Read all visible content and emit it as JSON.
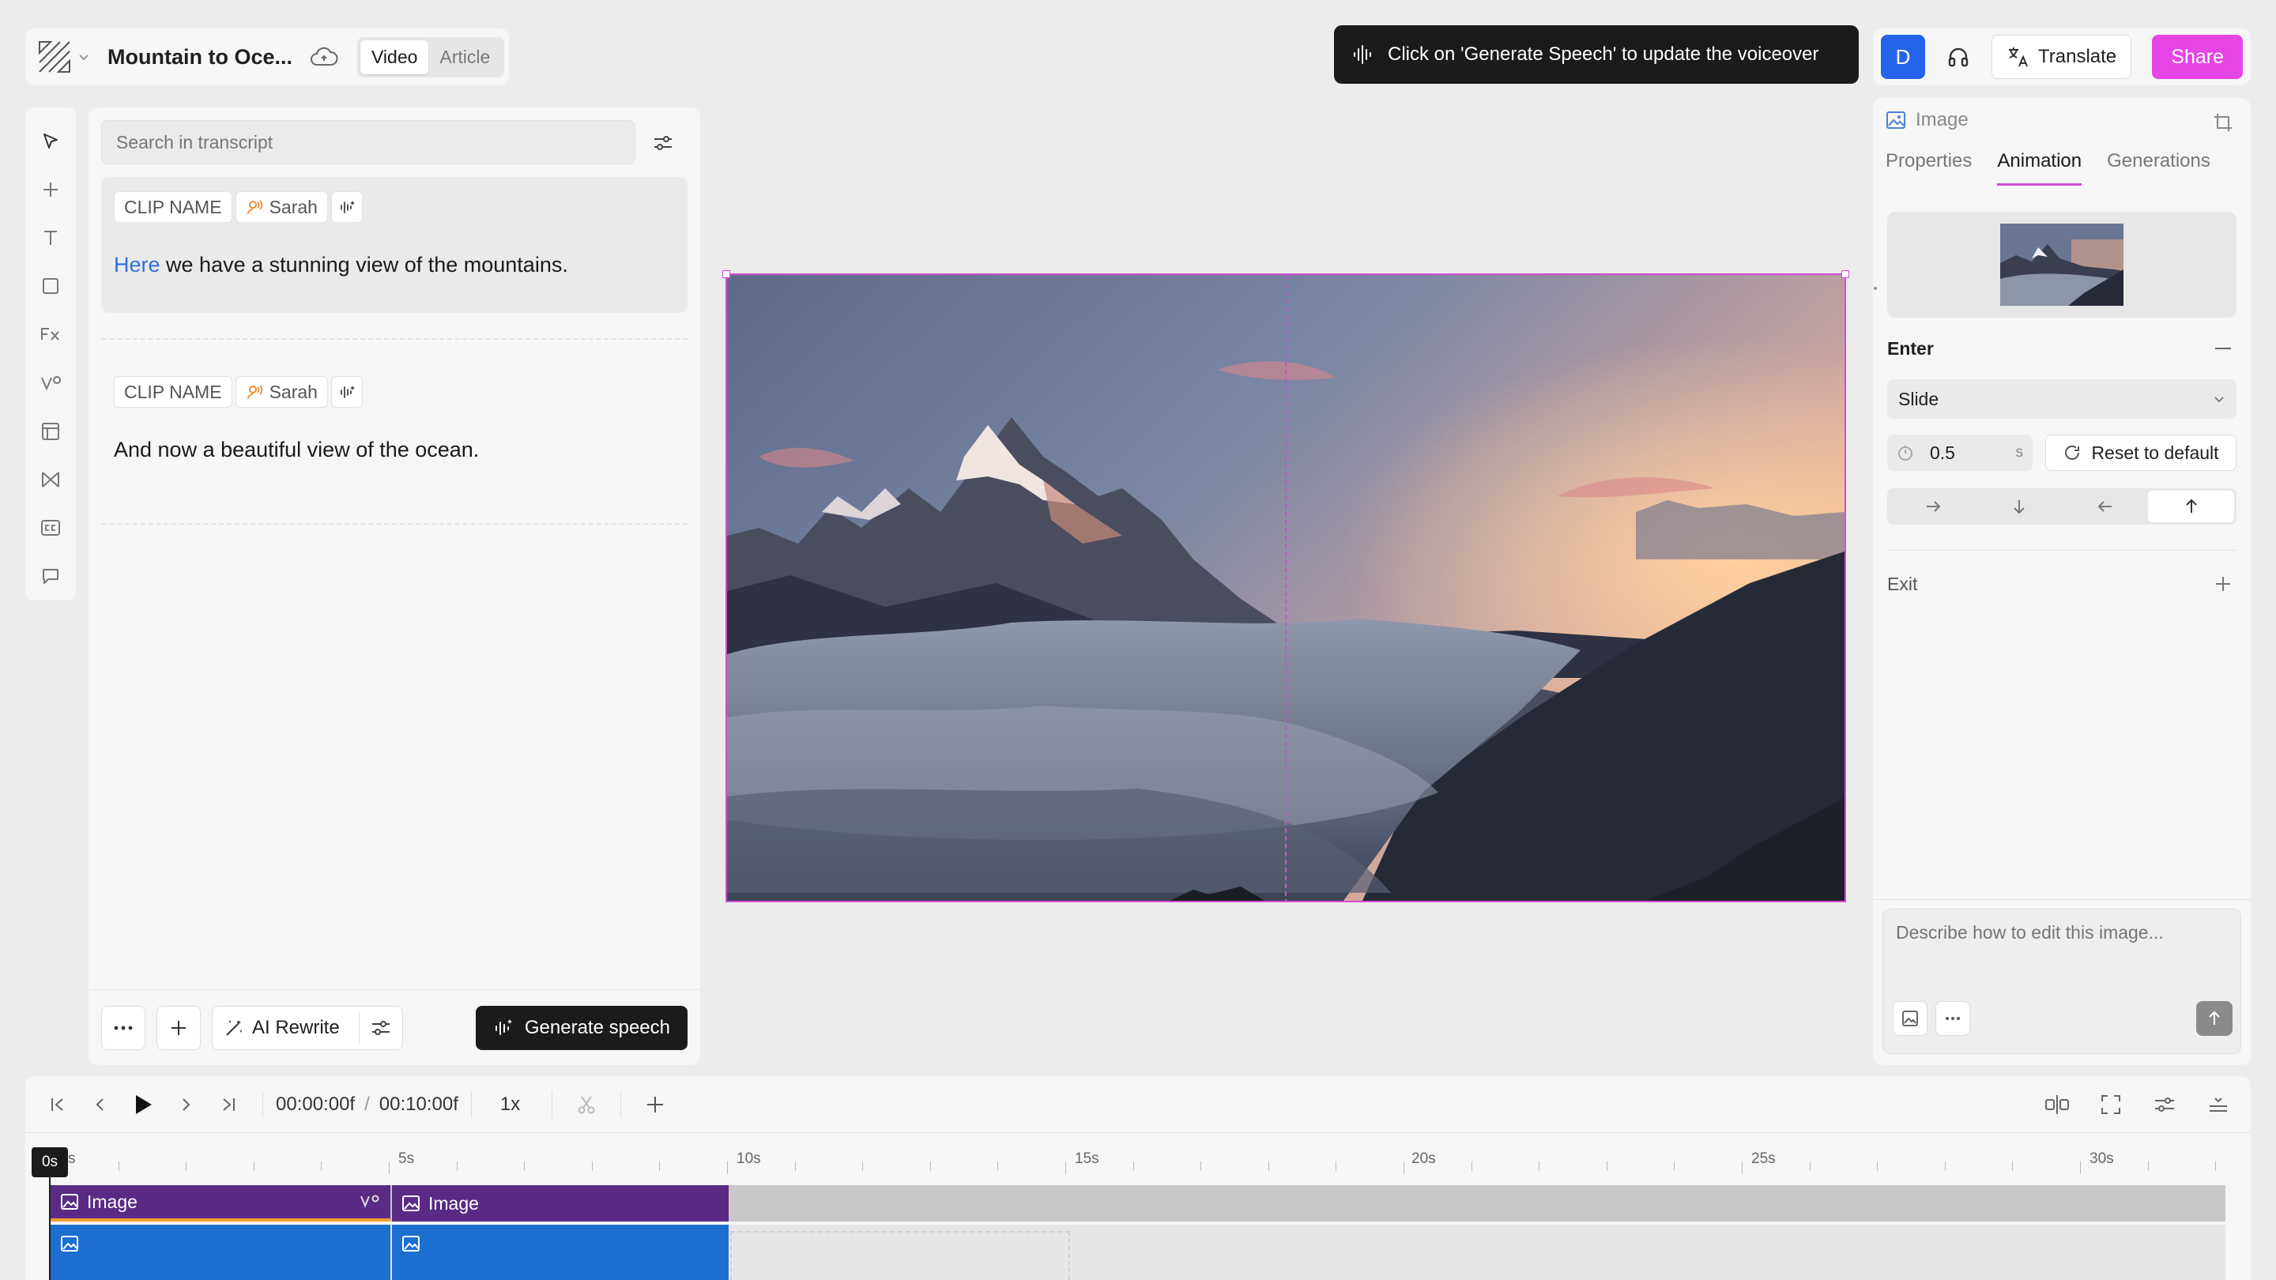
{
  "app": {
    "title": "Mountain to Oce...",
    "modes": [
      "Video",
      "Article"
    ],
    "active_mode": "Video"
  },
  "toast": {
    "text": "Click on 'Generate Speech' to update the voiceover"
  },
  "header_right": {
    "avatar_initial": "D",
    "translate_label": "Translate",
    "share_label": "Share",
    "accent": "#e545e5"
  },
  "left_toolbar": [
    "cursor-icon",
    "plus-icon",
    "text-icon",
    "shape-icon",
    "effects-icon",
    "transition-icon",
    "layout-icon",
    "elements-icon",
    "captions-icon",
    "comment-icon"
  ],
  "transcript": {
    "search_placeholder": "Search in transcript",
    "clips": [
      {
        "name": "CLIP NAME",
        "speaker": "Sarah",
        "text_highlight": "Here",
        "text_rest": " we have a stunning view of the mountains.",
        "selected": true
      },
      {
        "name": "CLIP NAME",
        "speaker": "Sarah",
        "text_highlight": "",
        "text_rest": "And now a beautiful view of the ocean.",
        "selected": false
      }
    ],
    "footer": {
      "ai_rewrite_label": "AI Rewrite",
      "generate_label": "Generate speech"
    }
  },
  "inspector": {
    "object_label": "Image",
    "tabs": [
      "Properties",
      "Animation",
      "Generations"
    ],
    "active_tab": "Animation",
    "enter": {
      "label": "Enter",
      "type": "Slide",
      "duration": "0.5",
      "duration_unit": "s",
      "reset_label": "Reset to default",
      "directions": [
        "right",
        "down",
        "left",
        "up"
      ],
      "active_direction": "up"
    },
    "exit": {
      "label": "Exit"
    },
    "prompt_placeholder": "Describe how to edit this image..."
  },
  "timeline": {
    "current_time": "00:00:00f",
    "divider": "/",
    "total_time": "00:10:00f",
    "speed": "1x",
    "playhead_label": "0s",
    "ruler_labels": [
      "5s",
      "10s",
      "15s",
      "20s",
      "25s",
      "30s"
    ],
    "ruler_first": "s",
    "clips": [
      {
        "label": "Image"
      },
      {
        "label": "Image"
      }
    ]
  }
}
